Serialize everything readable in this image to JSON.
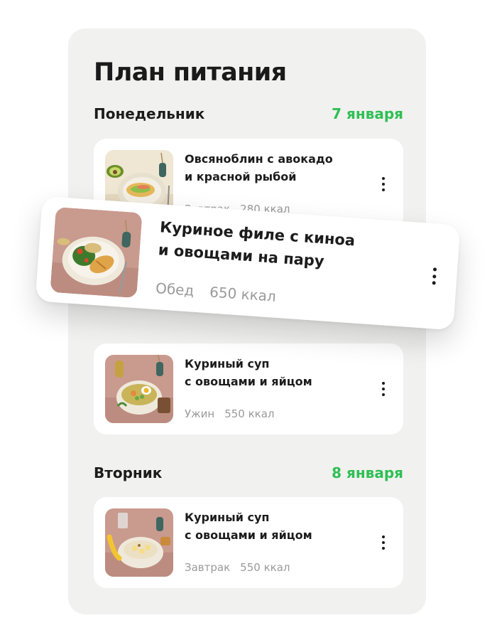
{
  "panel": {
    "title": "План питания"
  },
  "days": [
    {
      "label": "Понедельник",
      "date": "7 января",
      "meals": [
        {
          "title_line1": "Овсяноблин с авокадо",
          "title_line2": "и красной рыбой",
          "type": "Завтрак",
          "kcal": "280 ккал",
          "icon": "oat-pancake-avocado-icon"
        },
        {
          "title_line1": "Куриное филе с киноа",
          "title_line2": "и овощами на пару",
          "type": "Обед",
          "kcal": "650 ккал",
          "icon": "chicken-quinoa-plate-icon"
        },
        {
          "title_line1": "Куриный суп",
          "title_line2": "с овощами и яйцом",
          "type": "Ужин",
          "kcal": "550 ккал",
          "icon": "chicken-soup-bowl-icon"
        }
      ]
    },
    {
      "label": "Вторник",
      "date": "8 января",
      "meals": [
        {
          "title_line1": "Куриный суп",
          "title_line2": "с овощами и яйцом",
          "type": "Завтрак",
          "kcal": "550 ккал",
          "icon": "porridge-banana-bowl-icon"
        }
      ]
    }
  ],
  "colors": {
    "accent": "#2fbf55",
    "panel_bg": "#f1f1ef",
    "card_bg": "#ffffff",
    "muted_text": "#9a9a9a",
    "thumb_bg": "#c99a8e"
  }
}
